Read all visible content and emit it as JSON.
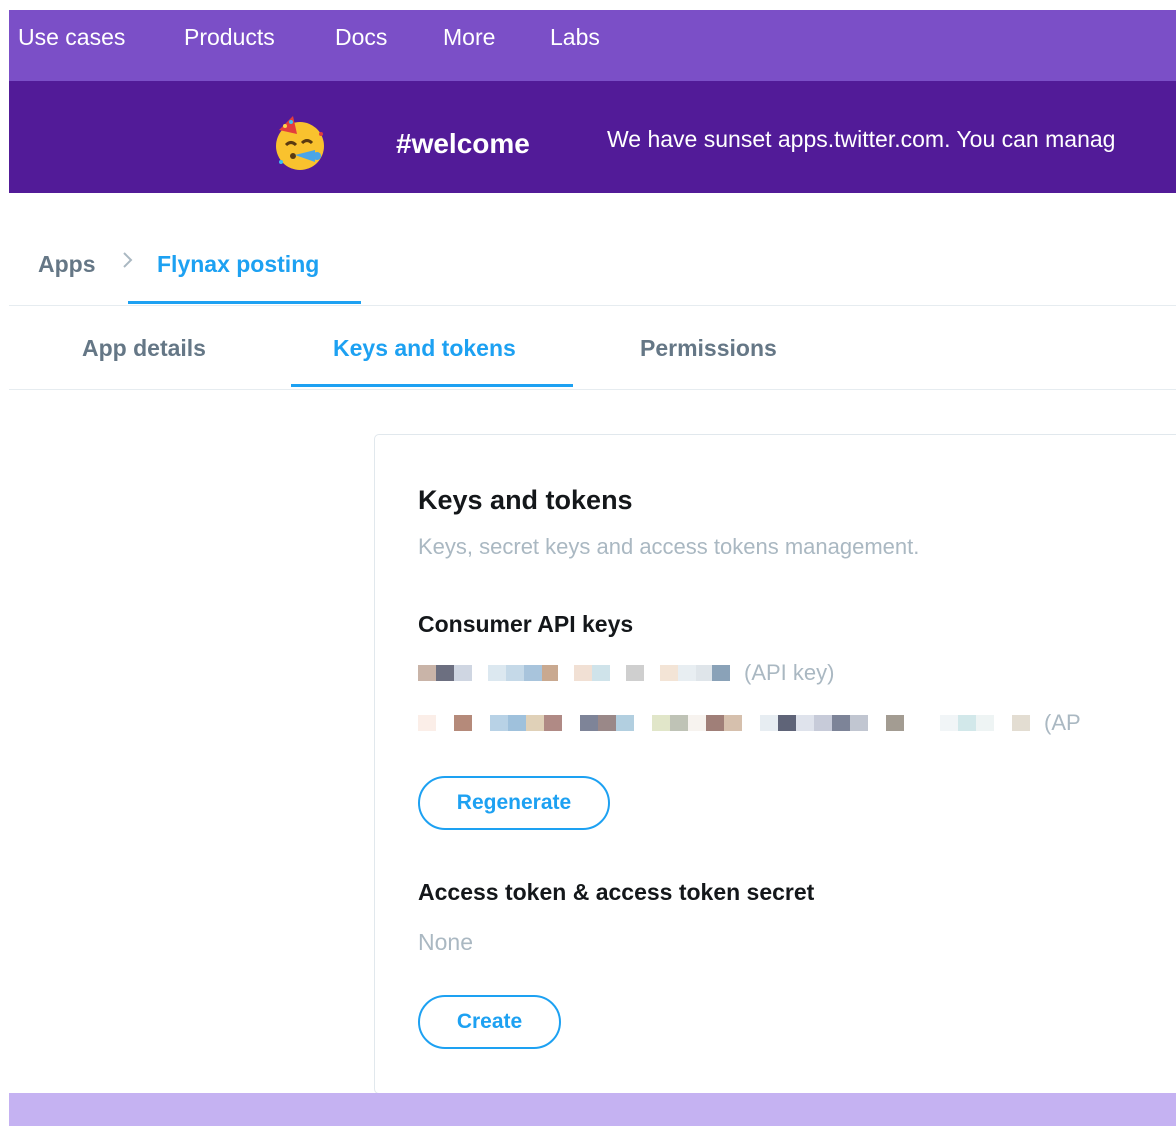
{
  "nav": {
    "items": [
      "Use cases",
      "Products",
      "Docs",
      "More",
      "Labs"
    ]
  },
  "banner": {
    "icon": "party-face-emoji",
    "channel": "#welcome",
    "message": "We have sunset apps.twitter.com. You can manag"
  },
  "breadcrumb": {
    "root": "Apps",
    "separator": ">",
    "current": "Flynax posting"
  },
  "tabs": [
    {
      "label": "App details",
      "active": false
    },
    {
      "label": "Keys and tokens",
      "active": true
    },
    {
      "label": "Permissions",
      "active": false
    }
  ],
  "card": {
    "title": "Keys and tokens",
    "subtitle": "Keys, secret keys and access tokens management.",
    "consumer": {
      "title": "Consumer API keys",
      "api_key_label": "(API key)",
      "api_secret_label": "(AP",
      "regenerate_label": "Regenerate"
    },
    "access": {
      "title": "Access token & access token secret",
      "value": "None",
      "create_label": "Create"
    }
  },
  "colors": {
    "nav_bg": "#7b4fc7",
    "banner_bg": "#521b98",
    "accent": "#1da1f2",
    "muted_text": "#aab8c2",
    "footer_bg": "#c5b2f2"
  }
}
